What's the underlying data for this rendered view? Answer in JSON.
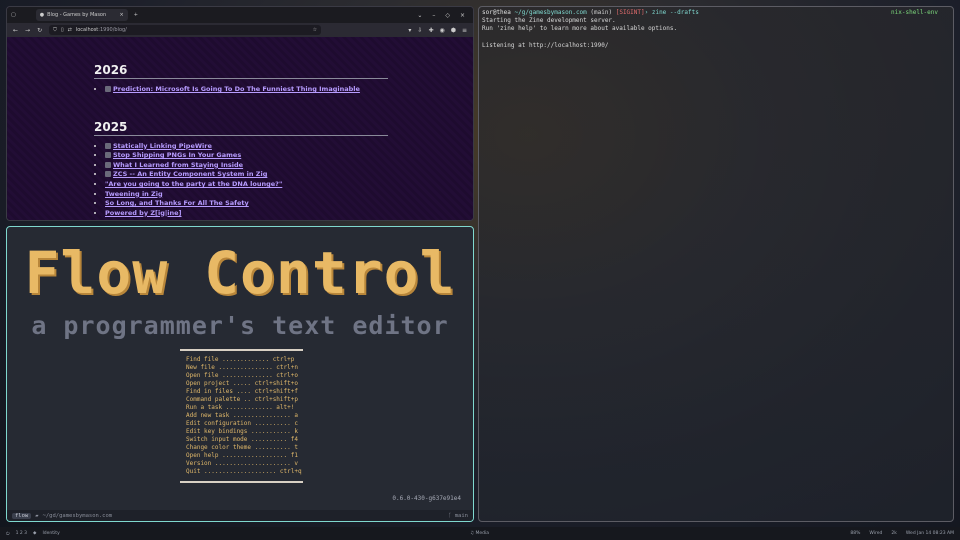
{
  "browser": {
    "tab_title": "Blog - Games by Mason",
    "url_host": "localhost",
    "url_path": ":1990/blog/",
    "sections": [
      {
        "year": "2026",
        "posts": [
          "Prediction: Microsoft Is Going To Do The Funniest Thing Imaginable"
        ]
      },
      {
        "year": "2025",
        "posts": [
          "Statically Linking PipeWire",
          "Stop Shipping PNGs In Your Games",
          "What I Learned from Staying Inside",
          "ZCS -- An Entity Component System in Zig",
          "\"Are you going to the party at the DNA lounge?\"",
          "Tweening in Zig",
          "So Long, and Thanks For All The Safety",
          "Powered by Z[ig|ine]"
        ]
      }
    ]
  },
  "flow": {
    "title": "Flow Control",
    "subtitle": "a programmer's text editor",
    "menu": [
      "Find file ............. ctrl+p",
      "New file ............... ctrl+n",
      "Open file .............. ctrl+o",
      "Open project ..... ctrl+shift+o",
      "Find in files .... ctrl+shift+f",
      "Command palette .. ctrl+shift+p",
      "Run a task ............. alt+!",
      "Add new task ................ a",
      "Edit configuration .......... c",
      "Edit key bindings ........... k",
      "Switch input mode .......... f4",
      "Change color theme .......... t",
      "Open help .................. f1",
      "Version ..................... v",
      "Quit .................... ctrl+q"
    ],
    "version": "0.6.0-430-g637e91e4",
    "status_mode": "flow",
    "status_path": "~/gd/gamesbymason.com",
    "status_branch": "main"
  },
  "terminal": {
    "prompt_user": "sor@thea",
    "prompt_path": "~/g/gamesbymason.com",
    "prompt_branch": "(main)",
    "prompt_signal": "[SIGINT]",
    "prompt_command": "› zine --drafts",
    "prompt_env": "nix-shell-env",
    "output": [
      "Starting the Zine development server.",
      "Run 'zine help' to learn more about available options.",
      "",
      "Listening at http://localhost:1990/"
    ]
  },
  "taskbar": {
    "workspaces": "1  2  3",
    "app_label": "Identity",
    "center_label": "Media",
    "tray": [
      "88%",
      "Wired",
      "2k",
      "Wed Jan 14 08:23 AM"
    ]
  }
}
